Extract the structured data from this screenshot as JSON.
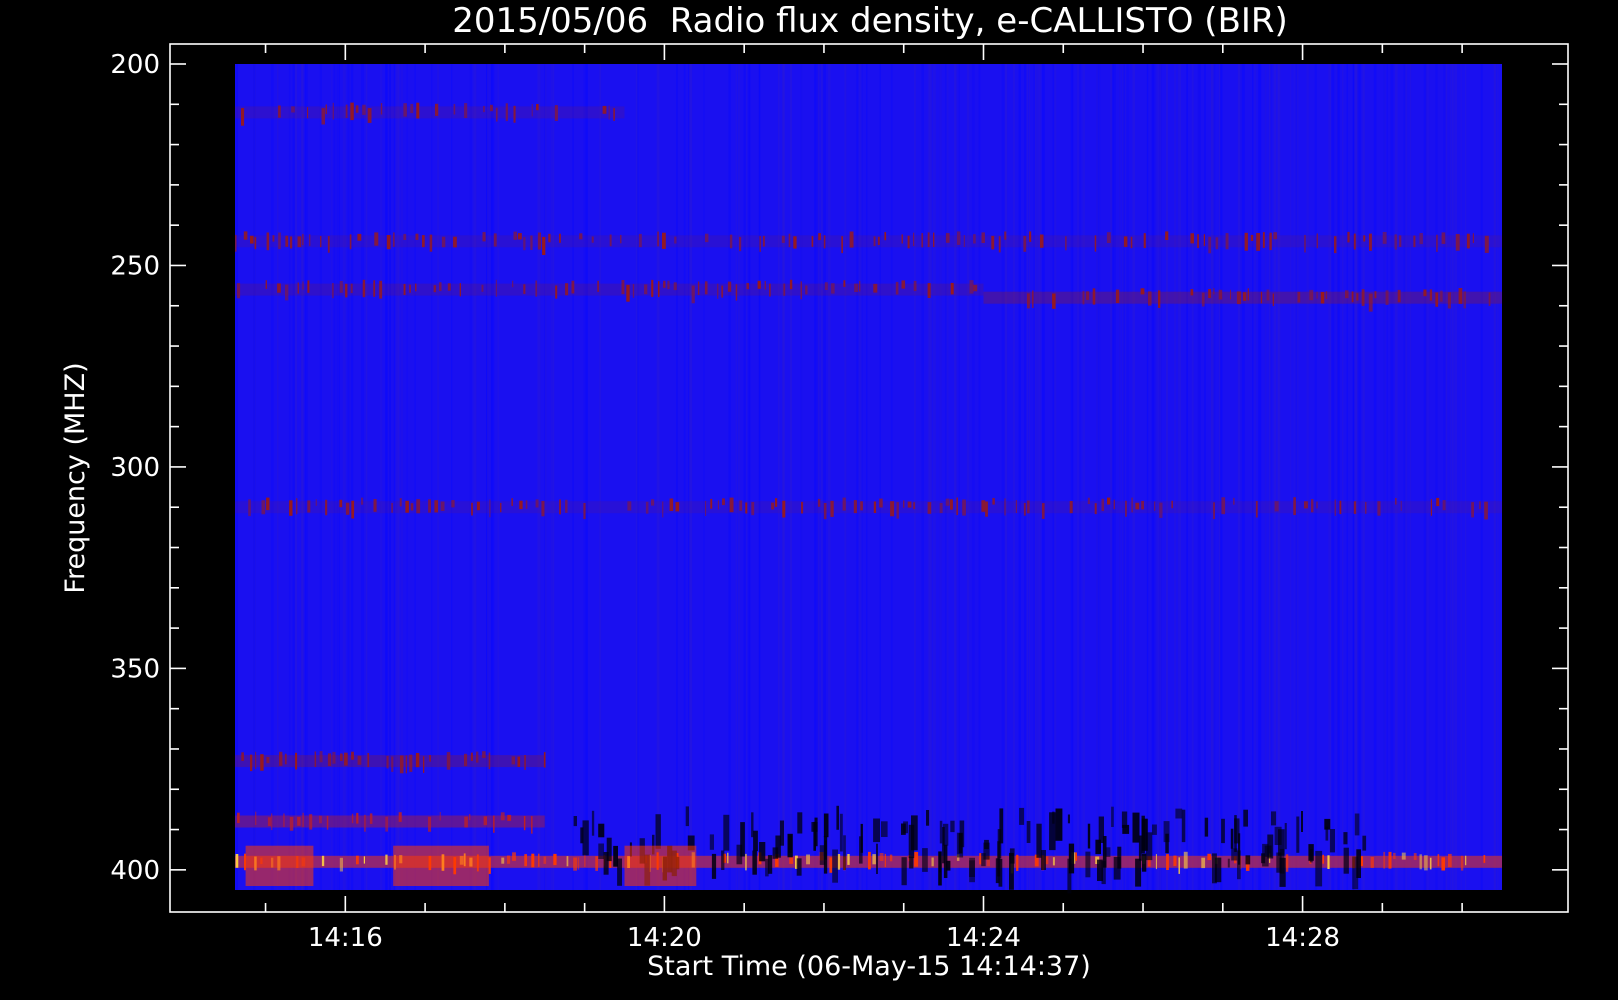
{
  "chart_data": {
    "type": "heatmap",
    "title": "2015/05/06  Radio flux density, e-CALLISTO (BIR)",
    "xlabel": "Start Time (06-May-15 14:14:37)",
    "ylabel": "Frequency (MHZ)",
    "x_tick_labels": [
      "14:16",
      "14:20",
      "14:24",
      "14:28"
    ],
    "x_tick_values_minutes": [
      16,
      20,
      24,
      28
    ],
    "x_minor_step_minutes": 1,
    "xlim_minutes": [
      14.617,
      30.5
    ],
    "y_tick_labels": [
      "200",
      "250",
      "300",
      "350",
      "400"
    ],
    "y_tick_values": [
      200,
      250,
      300,
      350,
      400
    ],
    "y_minor_step": 10,
    "ylim": [
      200,
      405
    ],
    "y_inverted": true,
    "colormap": [
      "#000000",
      "#1010ff",
      "#9a1a1a",
      "#ff3a00",
      "#ffd040"
    ],
    "background_color": "#1a10f0",
    "bands": [
      {
        "freq": 212,
        "intensity": 0.28,
        "x_range_minutes": [
          14.617,
          19.5
        ]
      },
      {
        "freq": 244,
        "intensity": 0.22,
        "x_range_minutes": [
          14.617,
          30.5
        ]
      },
      {
        "freq": 256,
        "intensity": 0.3,
        "x_range_minutes": [
          14.617,
          24.0
        ]
      },
      {
        "freq": 258,
        "intensity": 0.55,
        "x_range_minutes": [
          24.0,
          30.5
        ]
      },
      {
        "freq": 310,
        "intensity": 0.2,
        "x_range_minutes": [
          14.617,
          30.5
        ]
      },
      {
        "freq": 373,
        "intensity": 0.5,
        "x_range_minutes": [
          14.617,
          18.5
        ]
      },
      {
        "freq": 388,
        "intensity": 0.75,
        "x_range_minutes": [
          14.617,
          18.5
        ]
      },
      {
        "freq": 398,
        "intensity": 0.95,
        "x_range_minutes": [
          14.617,
          30.5
        ]
      }
    ]
  }
}
